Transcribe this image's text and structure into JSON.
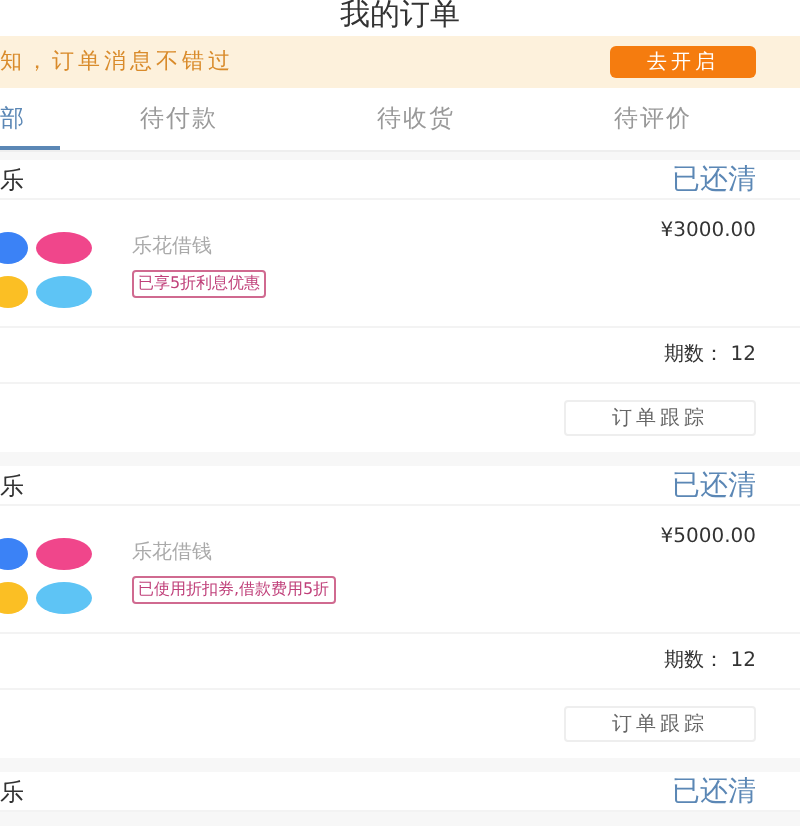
{
  "title": "我的订单",
  "banner": {
    "text": "知，订单消息不错过",
    "button": "去开启"
  },
  "tabs": [
    {
      "label": "部",
      "selected": true
    },
    {
      "label": "待付款",
      "selected": false
    },
    {
      "label": "待收货",
      "selected": false
    },
    {
      "label": "待评价",
      "selected": false
    }
  ],
  "orders": [
    {
      "store": "乐",
      "status": "已还清",
      "product": "乐花借钱",
      "tag": "已享5折利息优惠",
      "price": "¥3000.00",
      "periods": "期数： 12",
      "button": "订单跟踪"
    },
    {
      "store": "乐",
      "status": "已还清",
      "product": "乐花借钱",
      "tag": "已使用折扣券,借款费用5折",
      "price": "¥5000.00",
      "periods": "期数： 12",
      "button": "订单跟踪"
    },
    {
      "store": "乐",
      "status": "已还清"
    }
  ]
}
